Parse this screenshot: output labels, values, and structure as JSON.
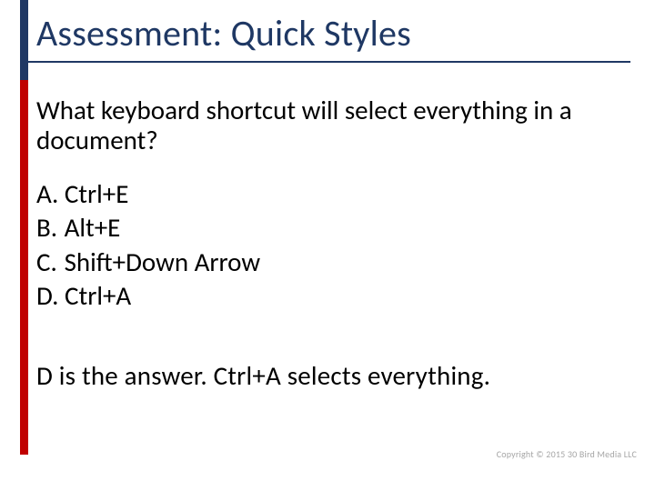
{
  "title": "Assessment: Quick Styles",
  "question": "What keyboard shortcut will select everything in a document?",
  "options": [
    {
      "label": "A.",
      "text": "Ctrl+E"
    },
    {
      "label": "B.",
      "text": "Alt+E"
    },
    {
      "label": "C.",
      "text": "Shift+Down Arrow"
    },
    {
      "label": "D.",
      "text": "Ctrl+A"
    }
  ],
  "answer": "D is the answer. Ctrl+A selects everything.",
  "copyright": "Copyright © 2015 30 Bird Media LLC"
}
